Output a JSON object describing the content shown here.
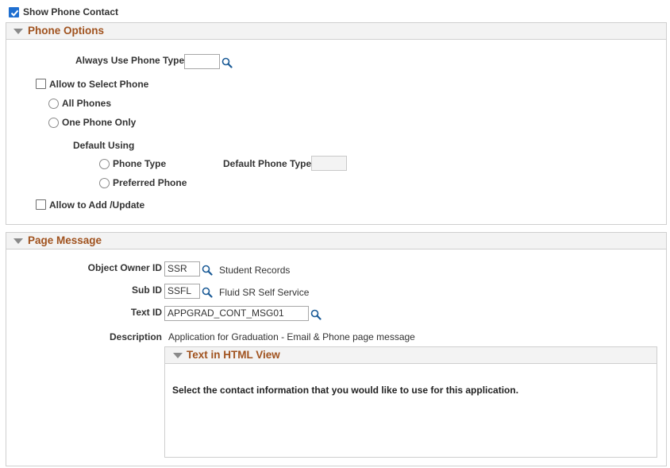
{
  "show_phone_contact": {
    "label": "Show Phone Contact",
    "checked": true
  },
  "phone_options": {
    "title": "Phone Options",
    "always_use_phone_type": {
      "label": "Always Use Phone Type",
      "value": ""
    },
    "allow_to_select_phone": {
      "label": "Allow to Select Phone",
      "checked": false
    },
    "all_phones": {
      "label": "All Phones"
    },
    "one_phone_only": {
      "label": "One Phone Only"
    },
    "default_using": {
      "label": "Default Using"
    },
    "phone_type": {
      "label": "Phone Type"
    },
    "preferred_phone": {
      "label": "Preferred Phone"
    },
    "default_phone_type": {
      "label": "Default Phone Type",
      "value": ""
    },
    "allow_to_add_update": {
      "label": "Allow to Add /Update",
      "checked": false
    }
  },
  "page_message": {
    "title": "Page Message",
    "object_owner_id": {
      "label": "Object Owner ID",
      "value": "SSR",
      "description": "Student Records"
    },
    "sub_id": {
      "label": "Sub ID",
      "value": "SSFL",
      "description": "Fluid SR Self Service"
    },
    "text_id": {
      "label": "Text ID",
      "value": "APPGRAD_CONT_MSG01"
    },
    "description": {
      "label": "Description",
      "value": "Application for Graduation - Email & Phone page message"
    },
    "html_view": {
      "title": "Text in HTML View",
      "content": "Select the contact information that you would like to use for this application."
    }
  },
  "colors": {
    "accent_title": "#a0521e",
    "checkbox_checked": "#1f6fd0",
    "header_bg": "#f3f3f3"
  }
}
